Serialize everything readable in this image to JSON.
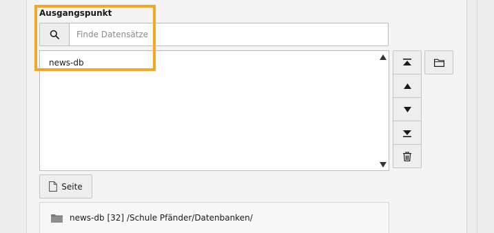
{
  "field": {
    "label": "Ausgangspunkt"
  },
  "search": {
    "placeholder": "Finde Datensätze",
    "value": ""
  },
  "list": {
    "items": [
      "news-db"
    ]
  },
  "buttons": {
    "page_label": "Seite"
  },
  "info": {
    "name": "news-db",
    "id": "[32]",
    "path": "/Schule Pfänder/Datenbanken/"
  },
  "icons": {
    "search": "search-icon",
    "move_top": "move-to-top-icon",
    "move_up": "move-up-icon",
    "move_down": "move-down-icon",
    "move_bottom": "move-to-bottom-icon",
    "delete": "trash-icon",
    "browse": "folder-icon",
    "page": "page-icon",
    "record": "folder-icon"
  },
  "colors": {
    "highlight": "#f5a623"
  }
}
